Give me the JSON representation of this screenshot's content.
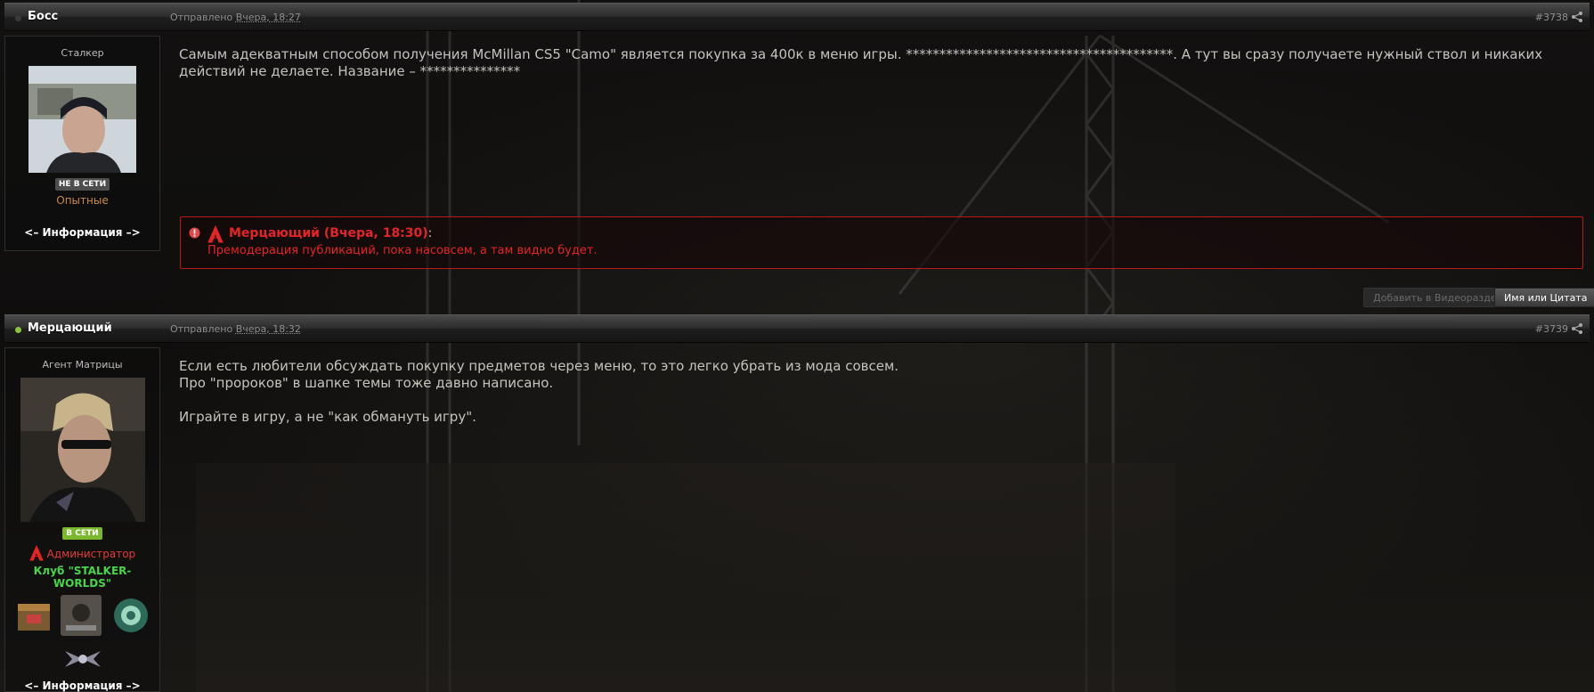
{
  "posts": [
    {
      "author": "Босс",
      "online": false,
      "date_prefix": "Отправлено",
      "date_rel": "Вчера, 18:27",
      "number": "#3738",
      "rank": "Сталкер",
      "status_badge": "НЕ В СЕТИ",
      "group": "Опытные",
      "info_link": "<– Информация –>",
      "body": "Самым адекватным способом получения McMillan CS5 \"Camo\" является покупка за 400к в меню игры. ****************************************. А тут вы сразу получаете нужный ствол и никаких действий не делаете. Название – ***************",
      "moderation": {
        "author": "Мерцающий",
        "date": "(Вчера, 18:30)",
        "colon": ":",
        "text": "Премодерация публикаций, пока насовсем, а там видно будет."
      },
      "buttons": {
        "add_video": "Добавить в Видеораздел",
        "quote": "Имя или Цитата"
      }
    },
    {
      "author": "Мерцающий",
      "online": true,
      "date_prefix": "Отправлено",
      "date_rel": "Вчера, 18:32",
      "number": "#3739",
      "rank": "Агент Матрицы",
      "status_badge": "В СЕТИ",
      "group": "Администратор",
      "club": "Клуб \"STALKER-WORLDS\"",
      "info_link": "<– Информация –>",
      "body_lines": [
        "Если есть любители обсуждать покупку предметов через меню, то это легко убрать из мода совсем.",
        "Про \"пророков\" в шапке темы тоже давно написано.",
        "",
        "Играйте в игру, а не \"как обмануть игру\"."
      ]
    }
  ],
  "colors": {
    "offline_badge": "#4e4e4e",
    "online_badge": "#7cb82f",
    "online_dot": "#8cc63f",
    "group_experienced": "#c98a4a",
    "group_admin": "#e53a3a",
    "club": "#48d548",
    "moderation_red": "#e32525"
  },
  "icons": [
    "share-icon",
    "warning-icon",
    "admin-a-icon"
  ]
}
